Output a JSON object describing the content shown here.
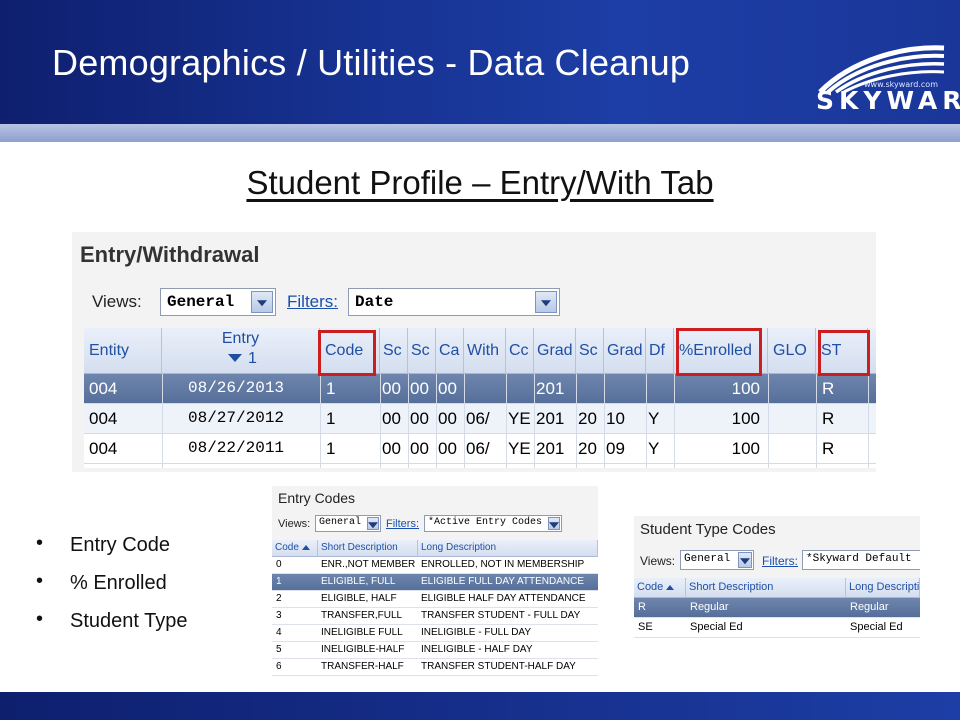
{
  "header": {
    "title": "Demographics / Utilities - Data Cleanup",
    "logo_url": "www.skyward.com",
    "logo_word": "SKYWARD",
    "logo_mark": "®"
  },
  "subtitle": "Student Profile – Entry/With Tab",
  "entry_withdrawal": {
    "title": "Entry/Withdrawal",
    "views_label": "Views:",
    "views_value": "General",
    "filters_label": "Filters:",
    "filters_value": "Date",
    "sort_indicator": "1",
    "columns": [
      "Entity",
      "Entry",
      "Code",
      "Sc",
      "Sc",
      "Ca",
      "With",
      "Cc",
      "Grad",
      "Sc",
      "Grad",
      "Df",
      "%Enrolled",
      "GLO",
      "ST"
    ],
    "rows": [
      [
        "004",
        "08/26/2013",
        "1",
        "00",
        "00",
        "00",
        "",
        "",
        "201",
        "",
        "",
        "",
        "100",
        "",
        "R"
      ],
      [
        "004",
        "08/27/2012",
        "1",
        "00",
        "00",
        "00",
        "06/",
        "YE",
        "201",
        "20",
        "10",
        "Y",
        "100",
        "",
        "R"
      ],
      [
        "004",
        "08/22/2011",
        "1",
        "00",
        "00",
        "00",
        "06/",
        "YE",
        "201",
        "20",
        "09",
        "Y",
        "100",
        "",
        "R"
      ]
    ]
  },
  "bullets": [
    "Entry Code",
    "% Enrolled",
    "Student Type"
  ],
  "entry_codes": {
    "title": "Entry Codes",
    "views_label": "Views:",
    "views_value": "General",
    "filters_label": "Filters:",
    "filters_value": "*Active Entry Codes",
    "columns": [
      "Code",
      "Short Description",
      "Long Description"
    ],
    "rows": [
      [
        "0",
        "ENR.,NOT MEMBER",
        "ENROLLED, NOT IN MEMBERSHIP"
      ],
      [
        "1",
        "ELIGIBLE, FULL",
        "ELIGIBLE FULL DAY ATTENDANCE"
      ],
      [
        "2",
        "ELIGIBLE, HALF",
        "ELIGIBLE HALF DAY ATTENDANCE"
      ],
      [
        "3",
        "TRANSFER,FULL",
        "TRANSFER STUDENT - FULL DAY"
      ],
      [
        "4",
        "INELIGIBLE FULL",
        "INELIGIBLE - FULL DAY"
      ],
      [
        "5",
        "INELIGIBLE-HALF",
        "INELIGIBLE - HALF DAY"
      ],
      [
        "6",
        "TRANSFER-HALF",
        "TRANSFER STUDENT-HALF DAY"
      ]
    ]
  },
  "student_type_codes": {
    "title": "Student Type Codes",
    "views_label": "Views:",
    "views_value": "General",
    "filters_label": "Filters:",
    "filters_value": "*Skyward Default",
    "columns": [
      "Code",
      "Short Description",
      "Long Description"
    ],
    "rows": [
      [
        "R",
        "Regular",
        "Regular"
      ],
      [
        "SE",
        "Special Ed",
        "Special Ed"
      ]
    ]
  },
  "colors": {
    "header_blue": "#16318f",
    "selected_row": "#5f789f",
    "highlight_red": "#cc1e1e",
    "link_blue": "#1a4fb0"
  }
}
